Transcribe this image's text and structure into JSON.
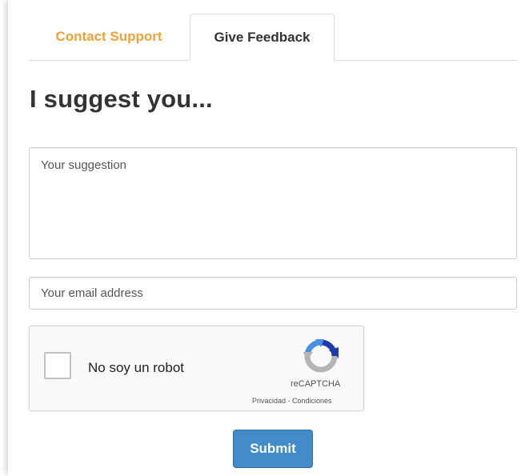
{
  "tabs": {
    "contact_support": "Contact Support",
    "give_feedback": "Give Feedback",
    "active": "Give Feedback"
  },
  "heading": "I suggest you...",
  "form": {
    "suggestion_placeholder": "Your suggestion",
    "suggestion_value": "",
    "email_placeholder": "Your email address",
    "email_value": "",
    "submit_label": "Submit"
  },
  "recaptcha": {
    "checkbox_label": "No soy un robot",
    "brand": "reCAPTCHA",
    "privacy_link": "Privacidad",
    "separator": " - ",
    "terms_link": "Condiciones",
    "checked": false,
    "logo_icon": "recaptcha-logo-icon"
  },
  "colors": {
    "inactive_tab": "#f0a13a",
    "submit_button": "#428bca",
    "heading_text": "#333333"
  }
}
